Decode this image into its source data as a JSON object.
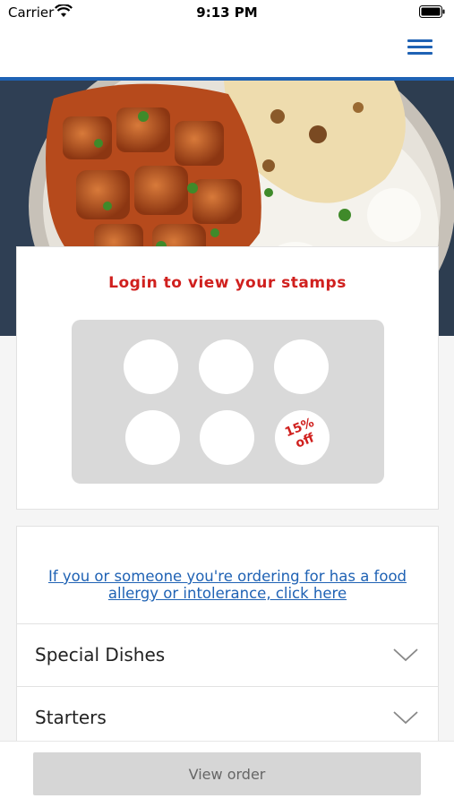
{
  "status_bar": {
    "carrier": "Carrier",
    "time": "9:13 PM"
  },
  "header": {
    "menu_icon": "hamburger-menu-icon",
    "accent_color": "#1f62b4"
  },
  "loyalty": {
    "title": "Login to view your stamps",
    "stamp_count": 6,
    "reward_line1": "15%",
    "reward_line2": "off",
    "title_color": "#d0201e"
  },
  "menu": {
    "allergy_link": "If you or someone you're ordering for has a food allergy or intolerance, click here",
    "categories": [
      {
        "label": "Special Dishes",
        "icon": "chevron-down-icon"
      },
      {
        "label": "Starters",
        "icon": "chevron-down-icon"
      }
    ]
  },
  "footer": {
    "view_order_label": "View order"
  }
}
